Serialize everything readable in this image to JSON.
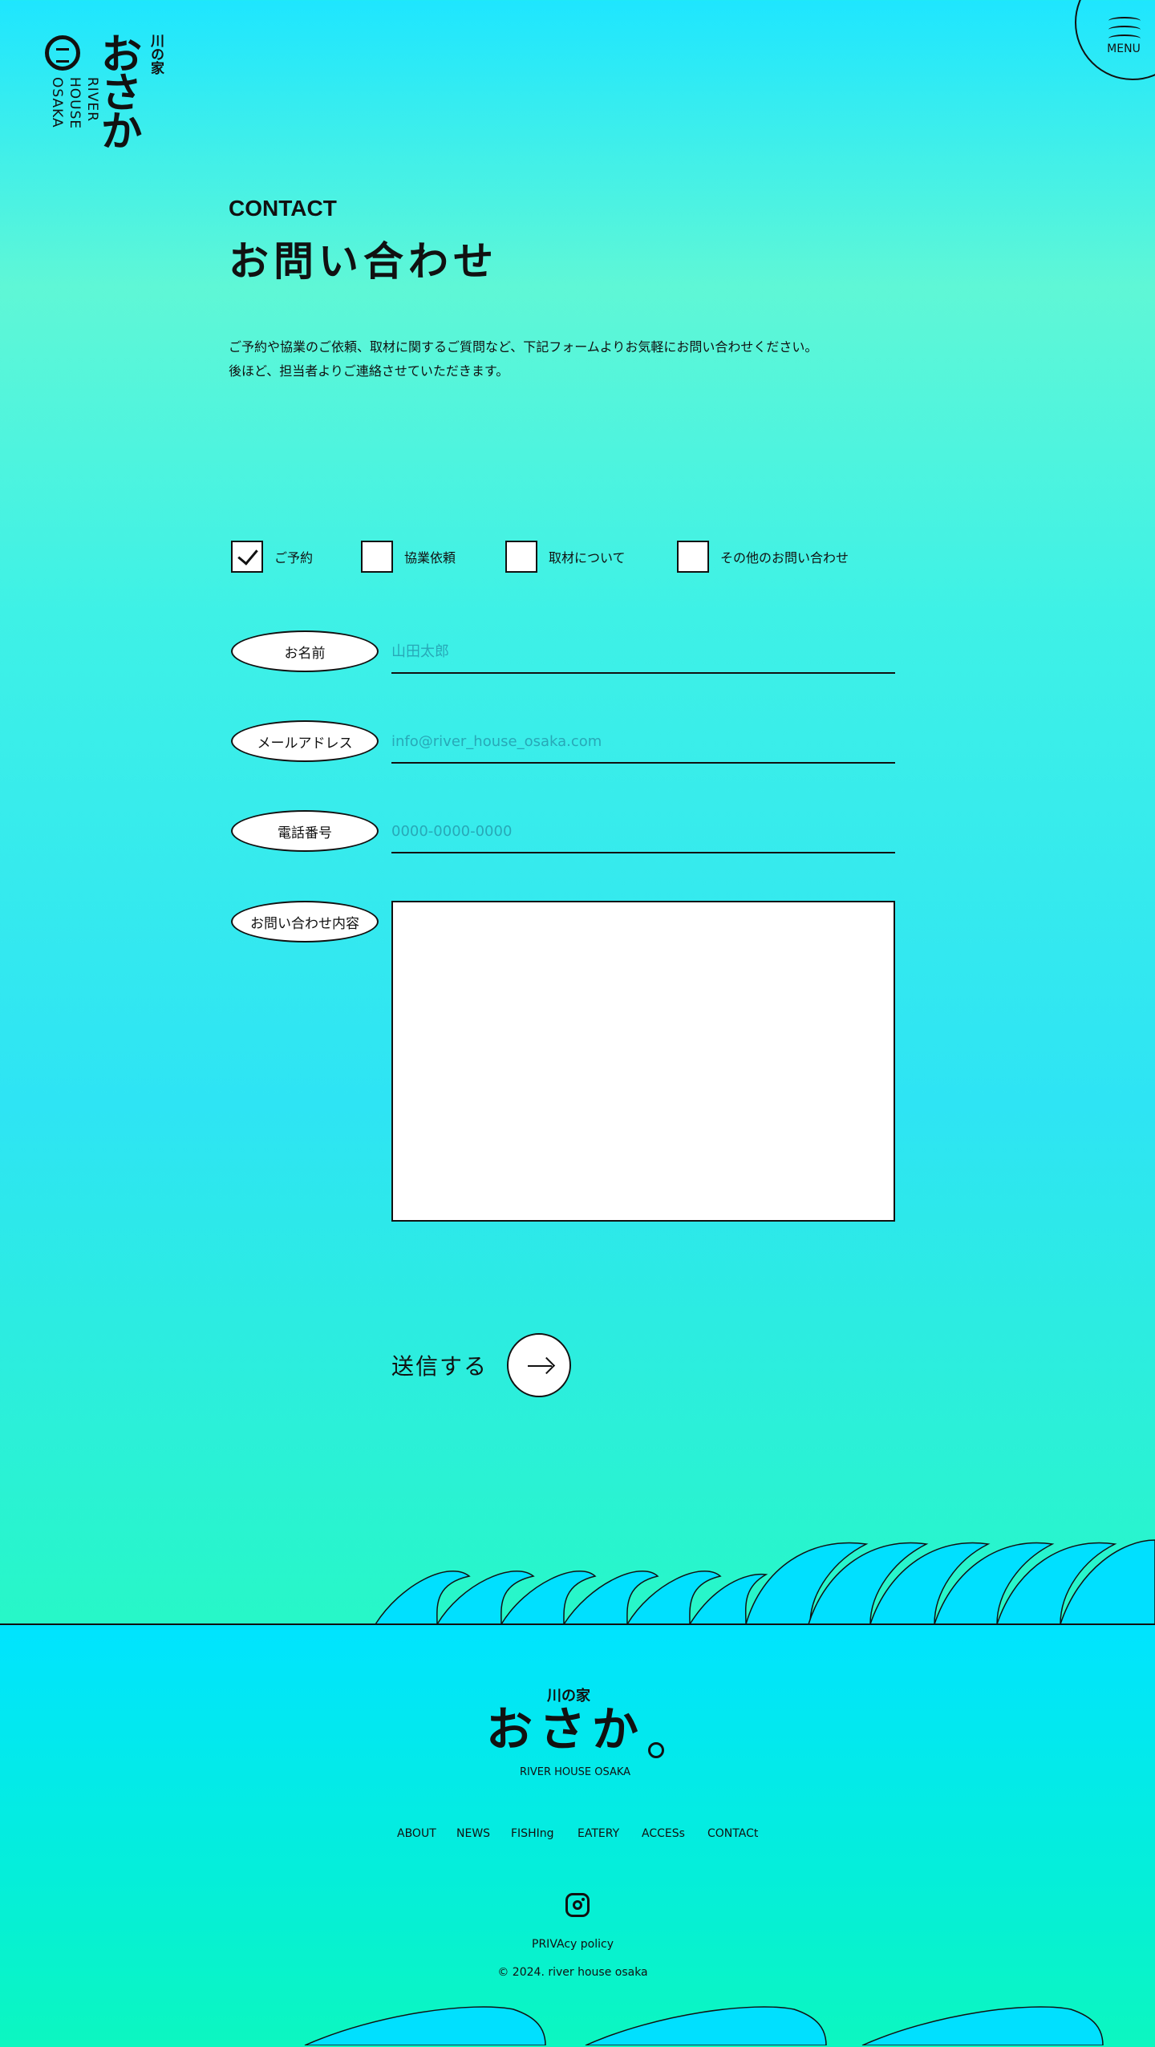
{
  "header": {
    "logo_small": "川の家",
    "logo_big": "おさか",
    "logo_sub": "RIVER HOUSE OSAKA",
    "menu_label": "MENU"
  },
  "main": {
    "eyebrow": "CONTACT",
    "title": "お問い合わせ",
    "intro_line1": "ご予約や協業のご依頼、取材に関するご質問など、下記フォームよりお気軽にお問い合わせください。",
    "intro_line2": "後ほど、担当者よりご連絡させていただきます。"
  },
  "form": {
    "checkboxes": [
      {
        "label": "ご予約",
        "checked": true
      },
      {
        "label": "協業依頼",
        "checked": false
      },
      {
        "label": "取材について",
        "checked": false
      },
      {
        "label": "その他のお問い合わせ",
        "checked": false
      }
    ],
    "name_label": "お名前",
    "name_placeholder": "山田太郎",
    "email_label": "メールアドレス",
    "email_placeholder": "info@river_house_osaka.com",
    "phone_label": "電話番号",
    "phone_placeholder": "0000-0000-0000",
    "message_label": "お問い合わせ内容",
    "message_value": "",
    "submit_label": "送信する"
  },
  "footer": {
    "logo_small": "川の家",
    "logo_big": "おさか",
    "logo_sub": "RIVER HOUSE OSAKA",
    "nav": [
      "ABOUT",
      "NEWS",
      "FISHIng",
      "EATERY",
      "ACCESs",
      "CONTACt"
    ],
    "instagram_icon": "instagram-icon",
    "privacy": "PRIVAcy policy",
    "copyright": "© 2024. river house osaka"
  }
}
